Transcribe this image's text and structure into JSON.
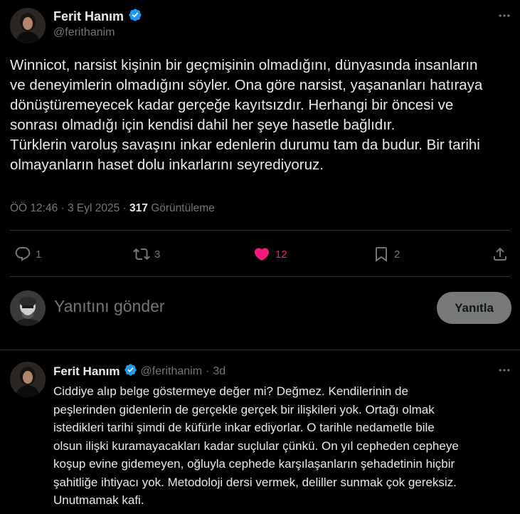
{
  "colors": {
    "accent": "#1d9bf0",
    "like": "#f91880",
    "muted": "#71767b",
    "background": "#000000"
  },
  "main_tweet": {
    "author_name": "Ferit Hanım",
    "author_handle": "@ferithanim",
    "text": "Winnicot, narsist kişinin bir geçmişinin olmadığını, dünyasında insanların\nve deneyimlerin olmadığını söyler. Ona göre narsist, yaşananları hatıraya\ndönüştüremeyecek kadar gerçeğe kayıtsızdır. Herhangi bir öncesi ve\nsonrası olmadığı için kendisi dahil her şeye hasetle bağlıdır.\nTürklerin varoluş savaşını inkar edenlerin durumu tam da budur. Bir tarihi\nolmayanların haset dolu inkarlarını seyrediyoruz.",
    "timestamp": "ÖÖ 12:46 · 3 Eyl 2025 · ",
    "views_count": "317",
    "views_label": " Görüntüleme",
    "actions": {
      "replies": "1",
      "reposts": "3",
      "likes": "12",
      "bookmarks": "2"
    },
    "icons": [
      "more-icon",
      "verified-icon",
      "reply-icon",
      "repost-icon",
      "like-icon",
      "bookmark-icon",
      "share-icon"
    ]
  },
  "composer": {
    "placeholder": "Yanıtını gönder",
    "button_label": "Yanıtla"
  },
  "reply_tweet": {
    "author_name": "Ferit Hanım",
    "author_handle": "@ferithanim",
    "separator": "·",
    "time": "3d",
    "text": "Ciddiye alıp belge göstermeye değer mi? Değmez. Kendilerinin de\npeşlerinden gidenlerin de gerçekle gerçek bir ilişkileri yok. Ortağı olmak\nistedikleri tarihi şimdi de küfürle inkar ediyorlar. O tarihle nedametle bile\nolsun ilişki kuramayacakları kadar suçlular çünkü. On yıl cepheden cepheye\nkoşup evine gidemeyen, oğluyla cephede karşılaşanların şehadetinin hiçbir\nşahitliğe ihtiyacı yok. Metodoloji dersi vermek, deliller sunmak çok gereksiz.\nUnutmamak kafi."
  }
}
